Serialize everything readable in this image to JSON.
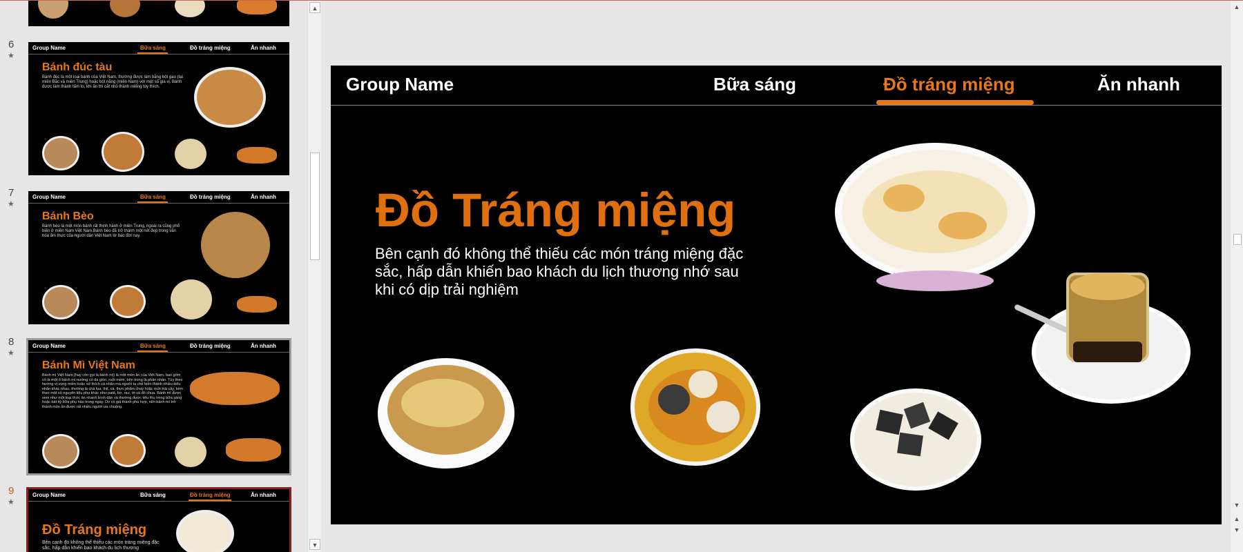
{
  "thumbnails": {
    "slide5_partial": {
      "num": ""
    },
    "slide6": {
      "num": "6",
      "group": "Group Name",
      "nav": [
        "Bữa sáng",
        "Đồ tráng miệng",
        "Ăn nhanh"
      ],
      "title": "Bánh đúc tàu",
      "body": "Bánh đúc là một loại bánh của Việt Nam, thường được làm bằng bột gạo (tại miền Bắc và miền Trung) hoặc bột năng (miền Nam) với một số gia vị. Bánh được làm thành tấm to, khi ăn thì cắt nhỏ thành miếng tùy thích."
    },
    "slide7": {
      "num": "7",
      "group": "Group Name",
      "nav": [
        "Bữa sáng",
        "Đồ tráng miệng",
        "Ăn nhanh"
      ],
      "title": "Bánh Bèo",
      "body": "Bánh bèo là một món bánh rất thịnh hành ở miền Trung, ngoài ra cũng phổ biến ở miền Nam Việt Nam.Bánh bèo đã trở thành một nét đẹp trong văn hóa ẩm thực của người dân Việt Nam từ bao đời nay."
    },
    "slide8": {
      "num": "8",
      "group": "Group Name",
      "nav": [
        "Bữa sáng",
        "Đồ tráng miệng",
        "Ăn nhanh"
      ],
      "title": "Bánh Mì Việt Nam",
      "body": "Bánh mì Việt Nam (hay còn gọi là bánh mì) là một món ăn của Việt Nam, bao gồm vỏ là một ổ bánh mì nướng có da giòn, ruột mềm, bên trong là phần nhân. Tùy theo hương vị vùng miền hoặc sở thích cá nhân mà người ta chế biến thành nhiều kiểu nhân khác nhau, thường là chả lụa, thịt, cá, thực phẩm chay hoặc mứt trái cây, kèm theo một số nguyên liệu phụ khác như patê, bơ, rau, ớt và đồ chua. Bánh mì được xem như một loại thức ăn nhanh bình dân và thường được tiêu thụ trong bữa sáng hoặc bất kỳ bữa phụ nào trong ngày. Do có giá thành phù hợp, nên bánh mì trở thành món ăn được rất nhiều người ưa chuộng."
    },
    "slide9": {
      "num": "9",
      "group": "Group Name",
      "nav": [
        "Bữa sáng",
        "Đồ tráng miệng",
        "Ăn nhanh"
      ],
      "title": "Đồ Tráng miệng",
      "body": "Bên cạnh đó không thể thiếu các món tráng miệng đặc sắc, hấp dẫn khiến bao khách du lịch thương"
    }
  },
  "slide": {
    "group_name": "Group Name",
    "nav": {
      "breakfast": "Bữa sáng",
      "dessert": "Đồ tráng miệng",
      "fastfood": "Ăn nhanh"
    },
    "title": "Đồ Tráng miệng",
    "subtitle": "Bên cạnh đó không thể thiếu các món tráng miệng đặc sắc, hấp dẫn khiến bao khách du lịch thương nhớ sau khi có dịp trải nghiệm"
  },
  "icons": {
    "star": "★",
    "up": "▲",
    "down": "▼"
  },
  "colors": {
    "accent": "#e67817",
    "slide_bg": "#000000",
    "current_thumb_border": "#8b1e1e"
  }
}
